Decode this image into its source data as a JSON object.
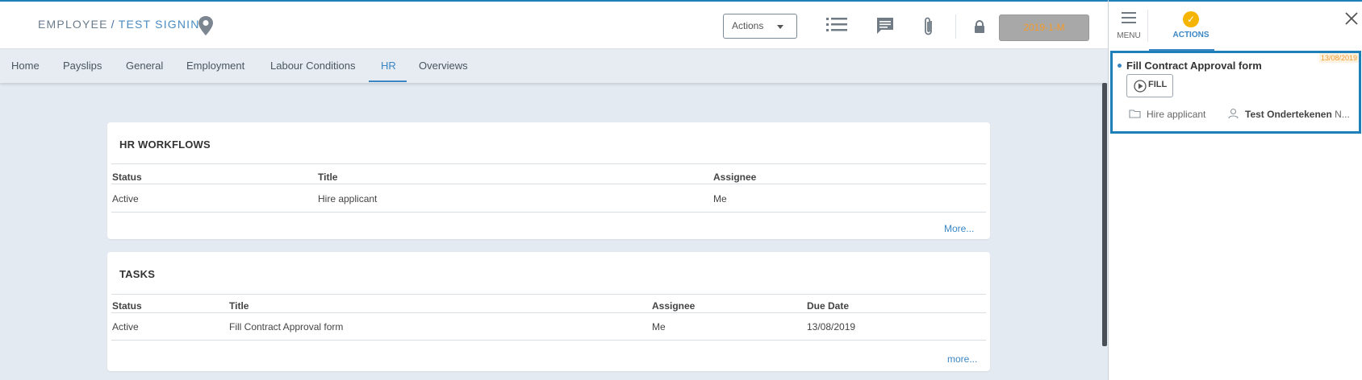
{
  "header": {
    "crumb_part1": "EMPLOYEE",
    "crumb_sep": "/",
    "crumb_part2": "TEST SIGNING",
    "actions_label": "Actions",
    "period_label": "2019-1-M"
  },
  "tabs": [
    {
      "label": "Home"
    },
    {
      "label": "Payslips"
    },
    {
      "label": "General"
    },
    {
      "label": "Employment"
    },
    {
      "label": "Labour Conditions"
    },
    {
      "label": "HR"
    },
    {
      "label": "Overviews"
    }
  ],
  "hr_workflows": {
    "title": "HR WORKFLOWS",
    "columns": [
      "Status",
      "Title",
      "Assignee"
    ],
    "rows": [
      [
        "Active",
        "Hire applicant",
        "Me"
      ]
    ],
    "more_label": "More..."
  },
  "tasks": {
    "title": "TASKS",
    "columns": [
      "Status",
      "Title",
      "Assignee",
      "Due Date"
    ],
    "rows": [
      [
        "Active",
        "Fill Contract Approval form",
        "Me",
        "13/08/2019"
      ]
    ],
    "more_label": "more..."
  },
  "panel": {
    "menu_label": "MENU",
    "actions_label": "ACTIONS",
    "task": {
      "title": "Fill Contract Approval form",
      "date": "13/08/2019",
      "fill_label": "FILL",
      "workflow": "Hire applicant",
      "assignee_bold": "Test Ondertekenen",
      "assignee_rest": "N..."
    }
  },
  "colors": {
    "accent": "#3a86c4",
    "header_border": "#1f7fb8",
    "period_text": "#f39a2b",
    "check": "#f5b400"
  }
}
